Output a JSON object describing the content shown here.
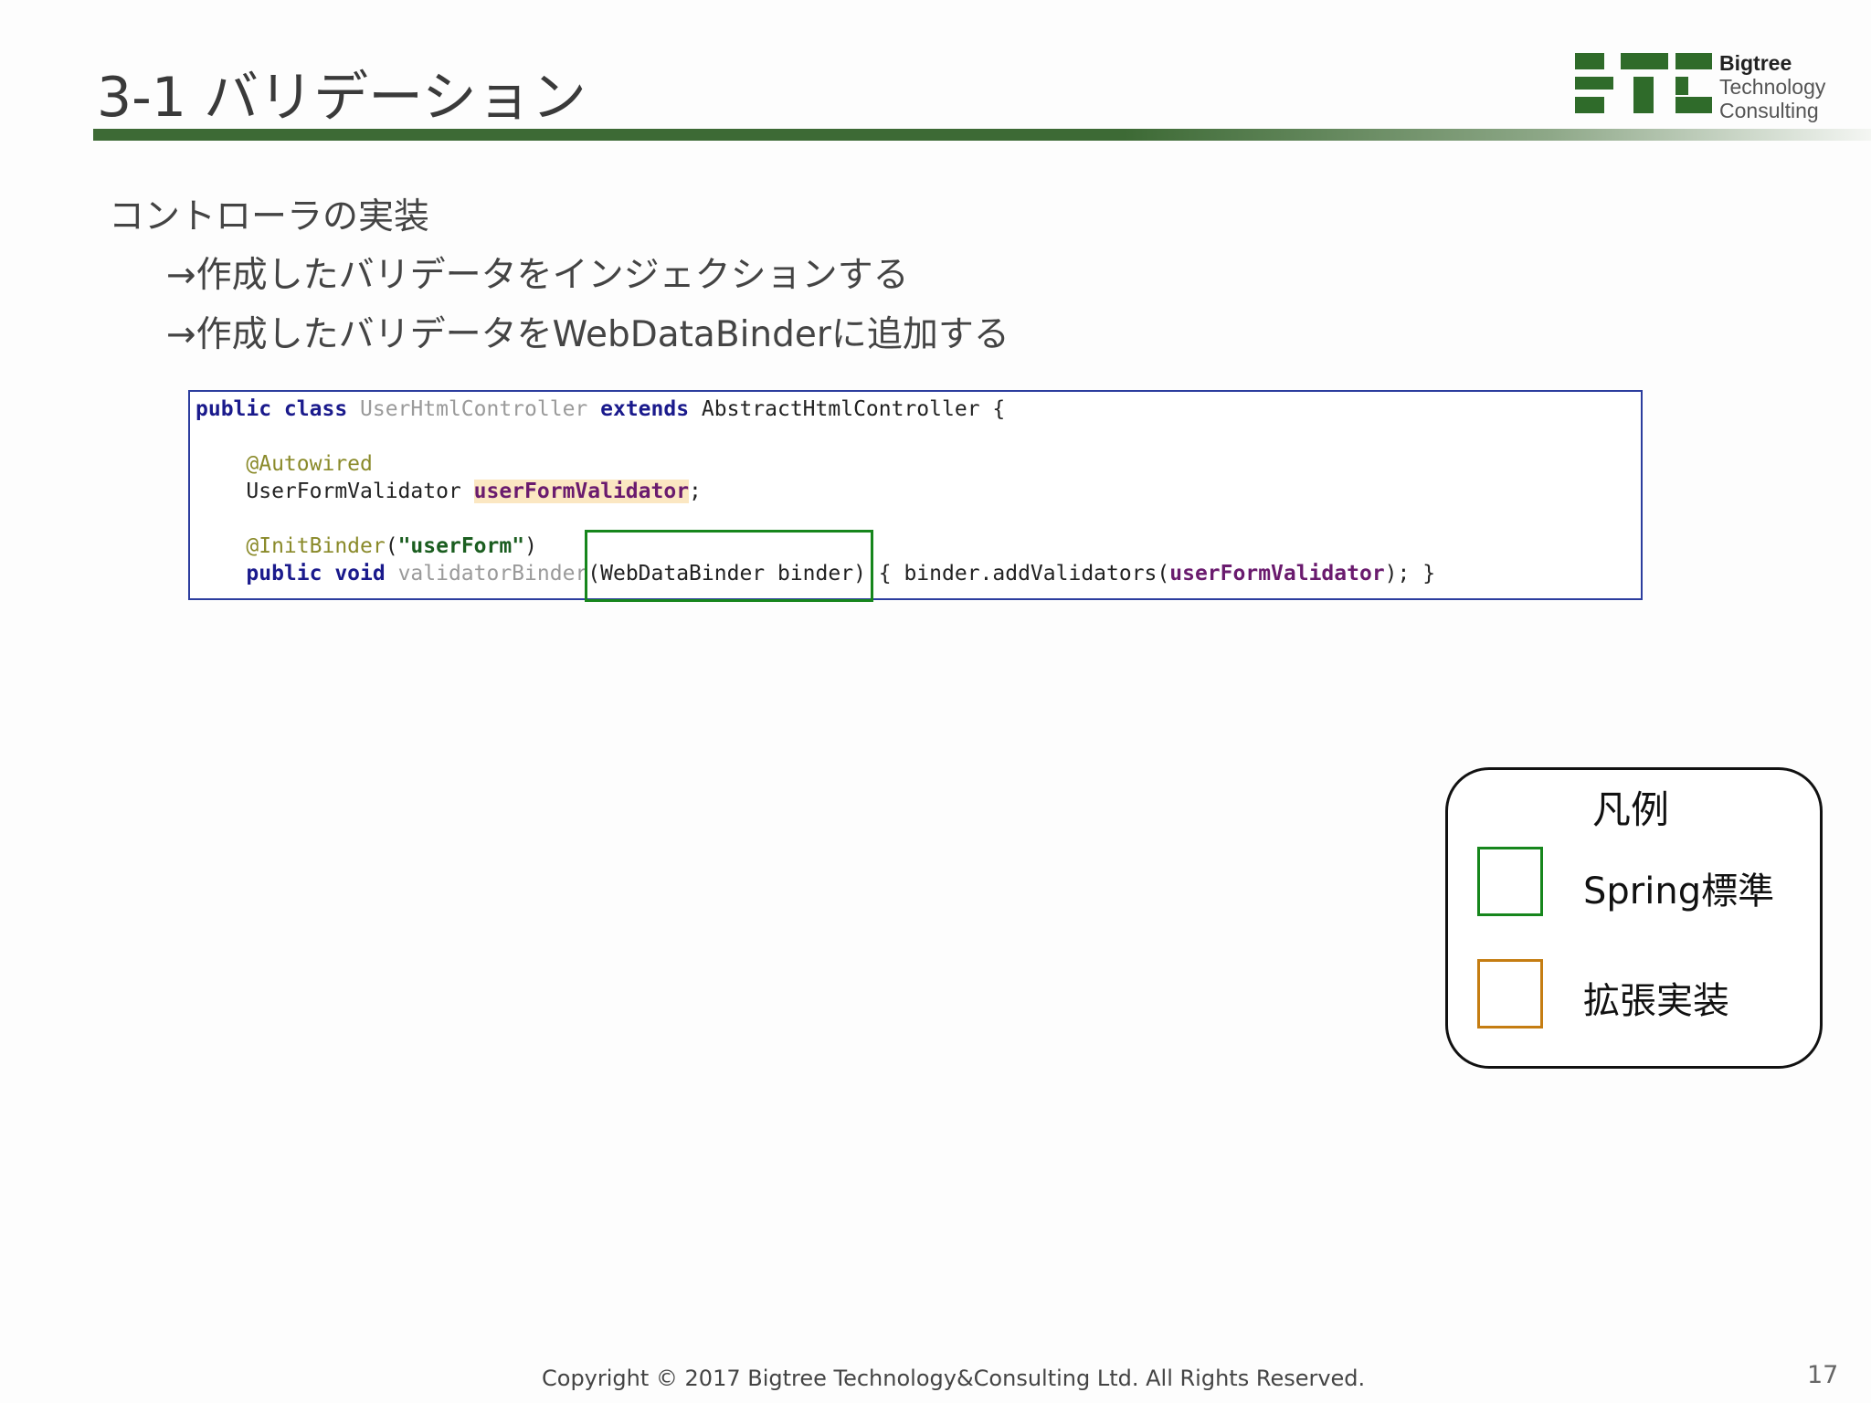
{
  "slide": {
    "title": "3-1 バリデーション",
    "bullets": [
      "コントローラの実装",
      "→作成したバリデータをインジェクションする",
      "→作成したバリデータをWebDataBinderに追加する"
    ],
    "code": {
      "line1": {
        "kw1": "public class ",
        "cls": "UserHtmlController ",
        "kw2": "extends ",
        "rest": "AbstractHtmlController {"
      },
      "line3": {
        "anno": "@Autowired"
      },
      "line4": {
        "type": "UserFormValidator ",
        "field": "userFormValidator",
        "end": ";"
      },
      "line6": {
        "anno": "@InitBinder",
        "open": "(",
        "str": "\"userForm\"",
        "close": ")"
      },
      "line7": {
        "kw": "public void ",
        "method": "validatorBinder",
        "params": "(WebDataBinder binder)",
        "body_start": " { binder.addValidators(",
        "field": "userFormValidator",
        "body_end": "); }"
      }
    },
    "legend": {
      "title": "凡例",
      "items": [
        {
          "label": "Spring標準",
          "color": "#16861c"
        },
        {
          "label": "拡張実装",
          "color": "#c57d12"
        }
      ]
    },
    "footer": "Copyright © 2017 Bigtree Technology&Consulting Ltd. All Rights Reserved.",
    "page_number": "17"
  },
  "logo": {
    "line1": "Bigtree",
    "line2": "Technology",
    "line3": "Consulting",
    "color": "#2f6b2a"
  }
}
